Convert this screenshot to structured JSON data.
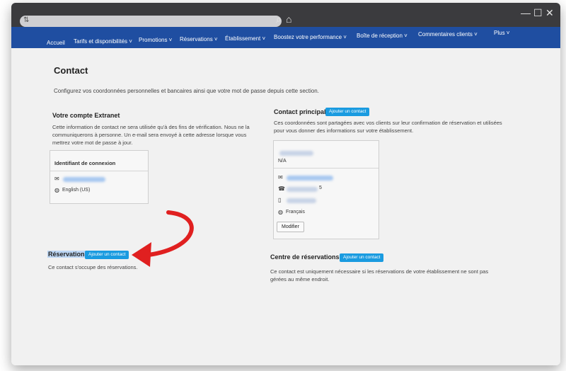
{
  "nav": {
    "items": [
      "Accueil",
      "Tarifs et disponibilités ˅",
      "Promotions ˅",
      "Réservations ˅",
      "Établissement ˅",
      "Boostez votre performance ˅",
      "Boîte de réception ˅",
      "Commentaires clients ˅",
      "Plus ˅"
    ]
  },
  "page": {
    "title": "Contact",
    "intro": "Configurez vos coordonnées personnelles et bancaires ainsi que votre mot de passe depuis cette section."
  },
  "extranet": {
    "title": "Votre compte Extranet",
    "text": "Cette information de contact ne sera utilisée qu'à des fins de vérification. Nous ne la communiquerons à personne. Un e-mail sera envoyé à cette adresse lorsque vous mettrez votre mot de passe à jour.",
    "box_title": "Identifiant de connexion",
    "language": "English (US)"
  },
  "main_contact": {
    "title": "Contact principal",
    "add_label": "Ajouter un contact",
    "text": "Ces coordonnées sont partagées avec vos clients sur leur confirmation de réservation et utilisées pour vous donner des informations sur votre établissement.",
    "role": "N/A",
    "phone_suffix": "5",
    "language": "Français",
    "modify_label": "Modifier"
  },
  "reservations": {
    "title": "Réservations",
    "add_label": "Ajouter un contact",
    "text": "Ce contact s'occupe des réservations."
  },
  "booking_centre": {
    "title": "Centre de réservations",
    "add_label": "Ajouter un contact",
    "text": "Ce contact est uniquement nécessaire si les réservations de votre établissement ne sont pas gérées au même endroit."
  },
  "colors": {
    "nav": "#1f4ea1",
    "accent": "#1a9be0",
    "arrow": "#e02020"
  }
}
